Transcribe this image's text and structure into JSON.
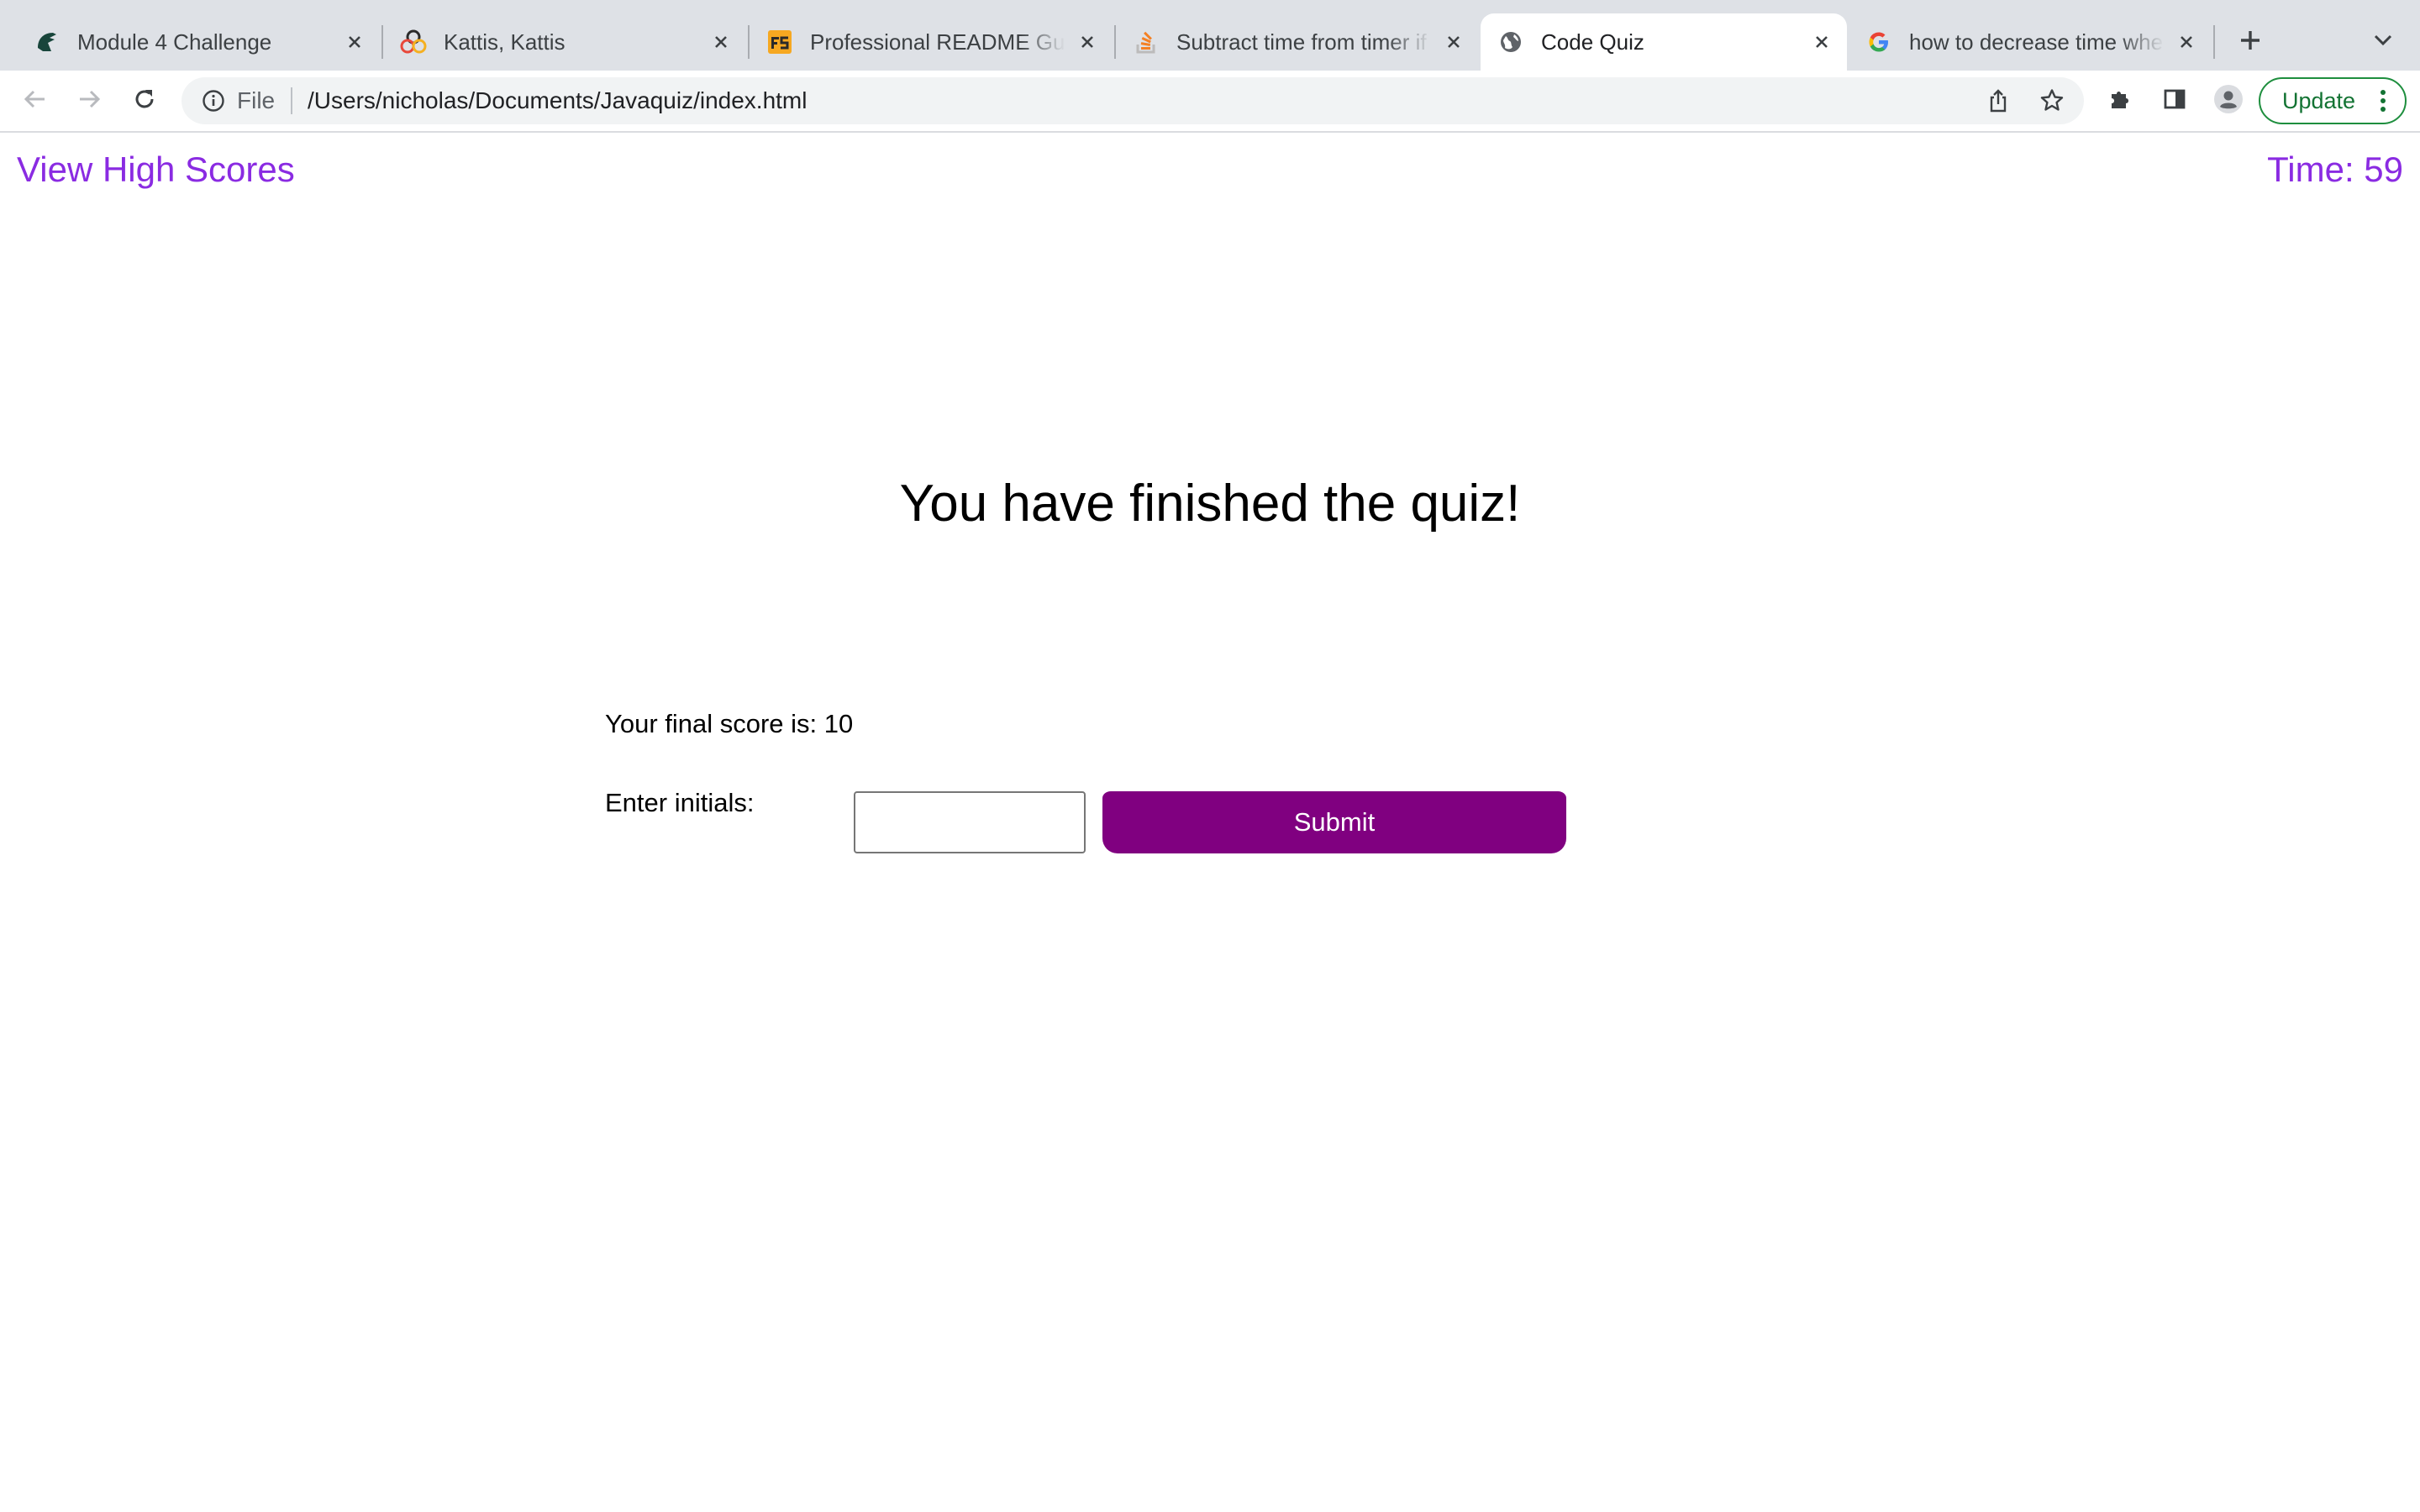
{
  "browser": {
    "tabs": [
      {
        "title": "Module 4 Challenge",
        "icon": "spartan-helmet-icon",
        "active": false
      },
      {
        "title": "Kattis, Kattis",
        "icon": "kattis-logo-icon",
        "active": false
      },
      {
        "title": "Professional README Guide",
        "icon": "fs-logo-icon",
        "active": false
      },
      {
        "title": "Subtract time from timer if",
        "icon": "stackoverflow-icon",
        "active": false
      },
      {
        "title": "Code Quiz",
        "icon": "globe-icon",
        "active": true
      },
      {
        "title": "how to decrease time when",
        "icon": "google-icon",
        "active": false
      }
    ],
    "address": {
      "scheme_label": "File",
      "url": "/Users/nicholas/Documents/Javaquiz/index.html"
    },
    "update_label": "Update",
    "colors": {
      "tabbar_bg": "#dee1e6",
      "update_green": "#137333"
    }
  },
  "page": {
    "high_scores_link": "View High Scores",
    "timer_text": "Time: 59",
    "heading": "You have finished the quiz!",
    "final_score_text": "Your final score is: 10",
    "initials_label": "Enter initials:",
    "initials_value": "",
    "submit_label": "Submit",
    "colors": {
      "accent": "#8a2be2",
      "submit_bg": "#800080"
    }
  }
}
